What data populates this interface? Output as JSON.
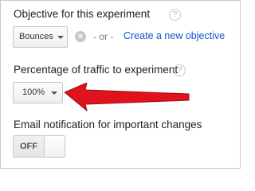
{
  "objective": {
    "label": "Objective for this experiment",
    "help_icon": "?",
    "dropdown_value": "Bounces",
    "clear_icon": "×",
    "or_text": "- or -",
    "create_link": "Create a new objective"
  },
  "traffic": {
    "label": "Percentage of traffic to experiment",
    "help_icon": "?",
    "dropdown_value": "100%"
  },
  "email": {
    "label": "Email notification for important changes",
    "toggle_state": "OFF"
  },
  "annotation": {
    "arrow_color": "#e0121b"
  }
}
